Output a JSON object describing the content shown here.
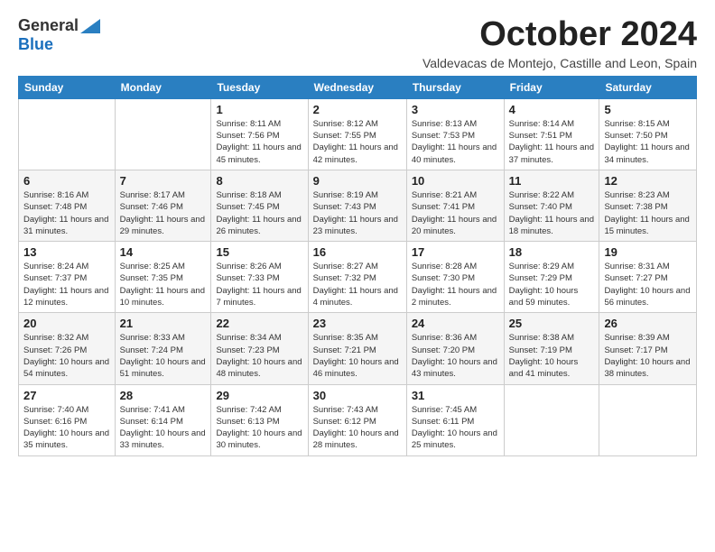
{
  "logo": {
    "general": "General",
    "blue": "Blue"
  },
  "title": "October 2024",
  "subtitle": "Valdevacas de Montejo, Castille and Leon, Spain",
  "days_of_week": [
    "Sunday",
    "Monday",
    "Tuesday",
    "Wednesday",
    "Thursday",
    "Friday",
    "Saturday"
  ],
  "weeks": [
    [
      {
        "day": "",
        "info": ""
      },
      {
        "day": "",
        "info": ""
      },
      {
        "day": "1",
        "info": "Sunrise: 8:11 AM\nSunset: 7:56 PM\nDaylight: 11 hours and 45 minutes."
      },
      {
        "day": "2",
        "info": "Sunrise: 8:12 AM\nSunset: 7:55 PM\nDaylight: 11 hours and 42 minutes."
      },
      {
        "day": "3",
        "info": "Sunrise: 8:13 AM\nSunset: 7:53 PM\nDaylight: 11 hours and 40 minutes."
      },
      {
        "day": "4",
        "info": "Sunrise: 8:14 AM\nSunset: 7:51 PM\nDaylight: 11 hours and 37 minutes."
      },
      {
        "day": "5",
        "info": "Sunrise: 8:15 AM\nSunset: 7:50 PM\nDaylight: 11 hours and 34 minutes."
      }
    ],
    [
      {
        "day": "6",
        "info": "Sunrise: 8:16 AM\nSunset: 7:48 PM\nDaylight: 11 hours and 31 minutes."
      },
      {
        "day": "7",
        "info": "Sunrise: 8:17 AM\nSunset: 7:46 PM\nDaylight: 11 hours and 29 minutes."
      },
      {
        "day": "8",
        "info": "Sunrise: 8:18 AM\nSunset: 7:45 PM\nDaylight: 11 hours and 26 minutes."
      },
      {
        "day": "9",
        "info": "Sunrise: 8:19 AM\nSunset: 7:43 PM\nDaylight: 11 hours and 23 minutes."
      },
      {
        "day": "10",
        "info": "Sunrise: 8:21 AM\nSunset: 7:41 PM\nDaylight: 11 hours and 20 minutes."
      },
      {
        "day": "11",
        "info": "Sunrise: 8:22 AM\nSunset: 7:40 PM\nDaylight: 11 hours and 18 minutes."
      },
      {
        "day": "12",
        "info": "Sunrise: 8:23 AM\nSunset: 7:38 PM\nDaylight: 11 hours and 15 minutes."
      }
    ],
    [
      {
        "day": "13",
        "info": "Sunrise: 8:24 AM\nSunset: 7:37 PM\nDaylight: 11 hours and 12 minutes."
      },
      {
        "day": "14",
        "info": "Sunrise: 8:25 AM\nSunset: 7:35 PM\nDaylight: 11 hours and 10 minutes."
      },
      {
        "day": "15",
        "info": "Sunrise: 8:26 AM\nSunset: 7:33 PM\nDaylight: 11 hours and 7 minutes."
      },
      {
        "day": "16",
        "info": "Sunrise: 8:27 AM\nSunset: 7:32 PM\nDaylight: 11 hours and 4 minutes."
      },
      {
        "day": "17",
        "info": "Sunrise: 8:28 AM\nSunset: 7:30 PM\nDaylight: 11 hours and 2 minutes."
      },
      {
        "day": "18",
        "info": "Sunrise: 8:29 AM\nSunset: 7:29 PM\nDaylight: 10 hours and 59 minutes."
      },
      {
        "day": "19",
        "info": "Sunrise: 8:31 AM\nSunset: 7:27 PM\nDaylight: 10 hours and 56 minutes."
      }
    ],
    [
      {
        "day": "20",
        "info": "Sunrise: 8:32 AM\nSunset: 7:26 PM\nDaylight: 10 hours and 54 minutes."
      },
      {
        "day": "21",
        "info": "Sunrise: 8:33 AM\nSunset: 7:24 PM\nDaylight: 10 hours and 51 minutes."
      },
      {
        "day": "22",
        "info": "Sunrise: 8:34 AM\nSunset: 7:23 PM\nDaylight: 10 hours and 48 minutes."
      },
      {
        "day": "23",
        "info": "Sunrise: 8:35 AM\nSunset: 7:21 PM\nDaylight: 10 hours and 46 minutes."
      },
      {
        "day": "24",
        "info": "Sunrise: 8:36 AM\nSunset: 7:20 PM\nDaylight: 10 hours and 43 minutes."
      },
      {
        "day": "25",
        "info": "Sunrise: 8:38 AM\nSunset: 7:19 PM\nDaylight: 10 hours and 41 minutes."
      },
      {
        "day": "26",
        "info": "Sunrise: 8:39 AM\nSunset: 7:17 PM\nDaylight: 10 hours and 38 minutes."
      }
    ],
    [
      {
        "day": "27",
        "info": "Sunrise: 7:40 AM\nSunset: 6:16 PM\nDaylight: 10 hours and 35 minutes."
      },
      {
        "day": "28",
        "info": "Sunrise: 7:41 AM\nSunset: 6:14 PM\nDaylight: 10 hours and 33 minutes."
      },
      {
        "day": "29",
        "info": "Sunrise: 7:42 AM\nSunset: 6:13 PM\nDaylight: 10 hours and 30 minutes."
      },
      {
        "day": "30",
        "info": "Sunrise: 7:43 AM\nSunset: 6:12 PM\nDaylight: 10 hours and 28 minutes."
      },
      {
        "day": "31",
        "info": "Sunrise: 7:45 AM\nSunset: 6:11 PM\nDaylight: 10 hours and 25 minutes."
      },
      {
        "day": "",
        "info": ""
      },
      {
        "day": "",
        "info": ""
      }
    ]
  ]
}
